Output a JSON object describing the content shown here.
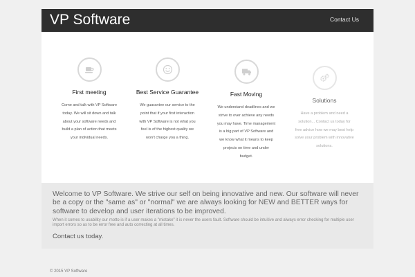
{
  "header": {
    "brand": "VP Software",
    "nav_contact": "Contact Us"
  },
  "features": [
    {
      "icon": "coffee-cup-icon",
      "title": "First meeting",
      "lines": [
        "Come and talk with VP Software",
        "today. We will sit down and talk",
        "about your software needs and",
        "build a plan of action that meets",
        "your individual needs."
      ]
    },
    {
      "icon": "smiley-icon",
      "title": "Best Service Guarantee",
      "lines": [
        "We guarantee our service to the",
        "point that if your first interaction",
        "with VP Software is not what you",
        "feel is of the highest quality we",
        "won't charge you a thing."
      ]
    },
    {
      "icon": "truck-icon",
      "title": "Fast Moving",
      "lines": [
        "We understand deadlines and we",
        "strive to over achieve any needs",
        "you may have. Time management",
        "is a big part of VP Software and",
        "we know what it means to keep",
        "projects on time and under",
        "budget."
      ]
    },
    {
      "icon": "gears-icon",
      "title": "Solutions",
      "lines": [
        "Have a problem and need a",
        "solution... Contact us today for",
        "free advice how we may best help",
        "solve your problem with innovative",
        "solutions."
      ]
    }
  ],
  "welcome": {
    "lead": "Welcome to VP Software. We strive our self on being innovative and new. Our software will never be a copy or the \"same as\" or \"normal\" we are always looking for NEW and BETTER ways for software to develop and user iterations to be improved.",
    "sub": "When it comes to usability our motto is if a user makes a \"mistake\" it is never the users fault. Software should be intuitive and always error checking for multiple user import errors so as to be error free and auto correcting at all times.",
    "cta": "Contact us today."
  },
  "footer": {
    "copyright": "© 2015 VP Software"
  },
  "colors": {
    "header_bg": "#2e2e2e",
    "page_bg": "#f0f0f0",
    "panel_bg": "#e9e9e9"
  }
}
